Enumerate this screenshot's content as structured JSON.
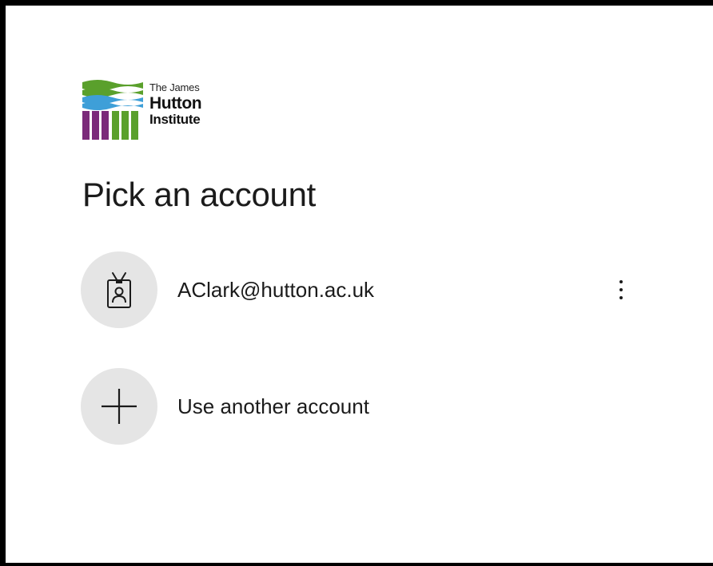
{
  "org": {
    "line1": "The James",
    "line2": "Hutton",
    "line3": "Institute",
    "colors": {
      "green": "#5aa02c",
      "blue": "#3e9fd8",
      "purple": "#7b2a7a"
    }
  },
  "title": "Pick an account",
  "accounts": [
    {
      "email": "AClark@hutton.ac.uk",
      "icon": "badge-person-icon",
      "more_icon": "more-options-icon"
    }
  ],
  "other_account": {
    "label": "Use another account",
    "icon": "plus-icon"
  }
}
